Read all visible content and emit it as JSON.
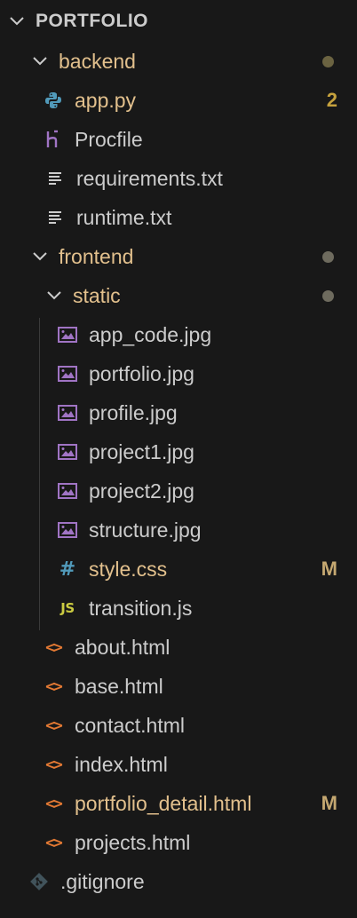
{
  "explorer": {
    "root": {
      "label": "PORTFOLIO"
    },
    "backend": {
      "label": "backend"
    },
    "app_py": {
      "label": "app.py",
      "badge": "2"
    },
    "procfile": {
      "label": "Procfile"
    },
    "requirements": {
      "label": "requirements.txt"
    },
    "runtime": {
      "label": "runtime.txt"
    },
    "frontend": {
      "label": "frontend"
    },
    "static": {
      "label": "static"
    },
    "app_code": {
      "label": "app_code.jpg"
    },
    "portfolio_jpg": {
      "label": "portfolio.jpg"
    },
    "profile_jpg": {
      "label": "profile.jpg"
    },
    "project1_jpg": {
      "label": "project1.jpg"
    },
    "project2_jpg": {
      "label": "project2.jpg"
    },
    "structure_jpg": {
      "label": "structure.jpg"
    },
    "style_css": {
      "label": "style.css",
      "badge": "M"
    },
    "transition_js": {
      "label": "transition.js"
    },
    "about_html": {
      "label": "about.html"
    },
    "base_html": {
      "label": "base.html"
    },
    "contact_html": {
      "label": "contact.html"
    },
    "index_html": {
      "label": "index.html"
    },
    "portfolio_detail_html": {
      "label": "portfolio_detail.html",
      "badge": "M"
    },
    "projects_html": {
      "label": "projects.html"
    },
    "gitignore": {
      "label": ".gitignore"
    }
  },
  "icons": {
    "css_glyph": "#",
    "js_glyph": "JS",
    "html_glyph": "<>"
  },
  "colors": {
    "background": "#181818",
    "text": "#cccccc",
    "modified": "#e2c08d",
    "html_icon": "#e37933",
    "image_icon": "#a074c4",
    "python_icon": "#519aba",
    "css_icon": "#519aba",
    "js_icon": "#cbcb41"
  }
}
